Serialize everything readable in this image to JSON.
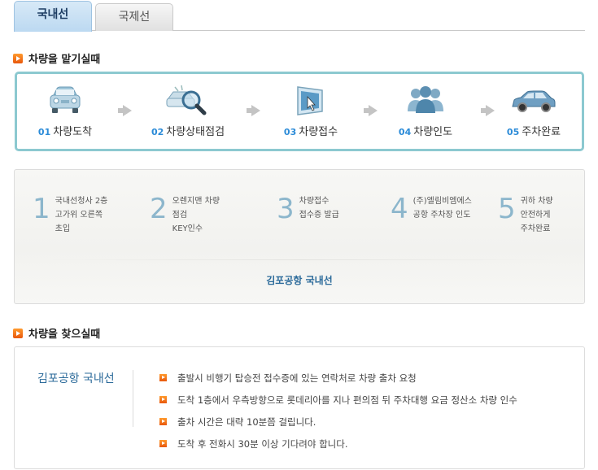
{
  "tabs": [
    {
      "label": "국내선",
      "active": true
    },
    {
      "label": "국제선",
      "active": false
    }
  ],
  "section_leave": {
    "title": "차량을 맡기실때"
  },
  "process_steps": [
    {
      "num": "01",
      "label": "차량도착",
      "icon": "car-front-icon"
    },
    {
      "num": "02",
      "label": "차량상태점검",
      "icon": "magnifier-car-icon"
    },
    {
      "num": "03",
      "label": "차량접수",
      "icon": "monitor-touch-icon"
    },
    {
      "num": "04",
      "label": "차량인도",
      "icon": "people-group-icon"
    },
    {
      "num": "05",
      "label": "주차완료",
      "icon": "car-side-icon"
    }
  ],
  "detail_steps": [
    {
      "num": "1",
      "lines": [
        "국내선청사 2층",
        "고가위 오른쪽",
        "초입"
      ]
    },
    {
      "num": "2",
      "lines": [
        "오렌지맨 차량",
        "점검",
        "KEY인수"
      ]
    },
    {
      "num": "3",
      "lines": [
        "차량접수",
        "접수증 발급"
      ]
    },
    {
      "num": "4",
      "lines": [
        "(주)엘림비엠에스",
        "공항 주차장 인도"
      ]
    },
    {
      "num": "5",
      "lines": [
        "귀하 차량",
        "안전하게",
        "주차완료"
      ]
    }
  ],
  "detail_caption": "김포공항 국내선",
  "section_find": {
    "title": "차량을 찾으실때"
  },
  "find": {
    "label": "김포공항 국내선",
    "items": [
      "출발시 비행기 탑승전 접수증에 있는 연락처로 차량 출차 요청",
      "도착 1층에서 우측방향으로 롯데리아를 지나 편의점 뒤 주차대행 요금 정산소 차량 인수",
      "출차 시간은 대략 10분쯤 걸립니다.",
      "도착 후 전화시 30분 이상 기다려야 합니다."
    ]
  },
  "colors": {
    "accent": "#2b8bd8",
    "border_teal": "#8cc9d0",
    "bullet": "#e8570c",
    "caption": "#2b6a9a"
  }
}
